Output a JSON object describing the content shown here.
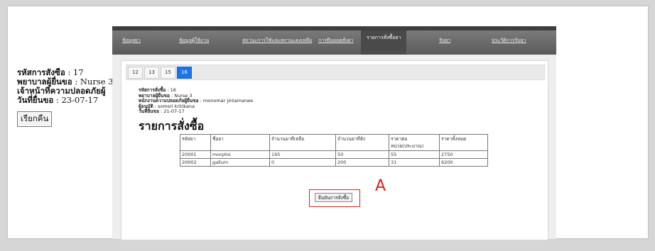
{
  "left_panel": {
    "order_id_label": "รหัสการสั่งซื้อ",
    "order_id_value": " : 17",
    "nurse_label": "พยาบาลผู้ยื่นขอ",
    "nurse_value": " : Nurse 3",
    "safety_label": "เจ้าหน้าที่ความปลอดภัยผู้",
    "date_label": "วันที่ยื่นขอ",
    "date_value": " : 23-07-17",
    "return_button": "เรียกคืน"
  },
  "nav": {
    "items": [
      "ข้อมูลยา",
      "ข้อมูลผู้ใช้งาน",
      "สถานะการใช้และสถานะคงเหลือ",
      "การยืนยอดสั่งยา",
      "รายการสั่งซื้อยา",
      "รับยา",
      "ประวัติการรับยา"
    ],
    "active_index": 4
  },
  "tabs": {
    "items": [
      "12",
      "13",
      "15",
      "16"
    ],
    "active": "16"
  },
  "details": {
    "order_id_label": "รหัสการสั่งซื้อ",
    "order_id_value": " : 16",
    "nurse_label": "พยาบาลผู้ยื่นขอ",
    "nurse_value": " : Nurse 3",
    "safety_label": "พนักงานความปลอดภัยผู้ยื่นขอ",
    "safety_value": " : monomar jintamanee",
    "approver_label": "ผู้อนุมัติ",
    "approver_value": " : somsri kritikana",
    "date_label": "วันที่ยื่นขอ",
    "date_value": " : 21-07-17"
  },
  "order_title": "รายการสั่งซื้อ",
  "table": {
    "headers": [
      "รหัสยา",
      "ชื่อยา",
      "จำนวนยาที่เหลือ",
      "จำนวนยาที่สั่ง",
      "ราคาต่อหน่วย(ประมาณ)",
      "ราคาทั้งหมด"
    ],
    "rows": [
      [
        "20001",
        "morphic",
        "195",
        "50",
        "55",
        "2750"
      ],
      [
        "20002",
        "gallum",
        "0",
        "200",
        "31",
        "6200"
      ]
    ]
  },
  "confirm_button": "ยืนยันการสั่งซื้อ",
  "annotation_label": "A",
  "colors": {
    "accent_blue": "#1a73e8",
    "annotation_red": "#d62222"
  }
}
